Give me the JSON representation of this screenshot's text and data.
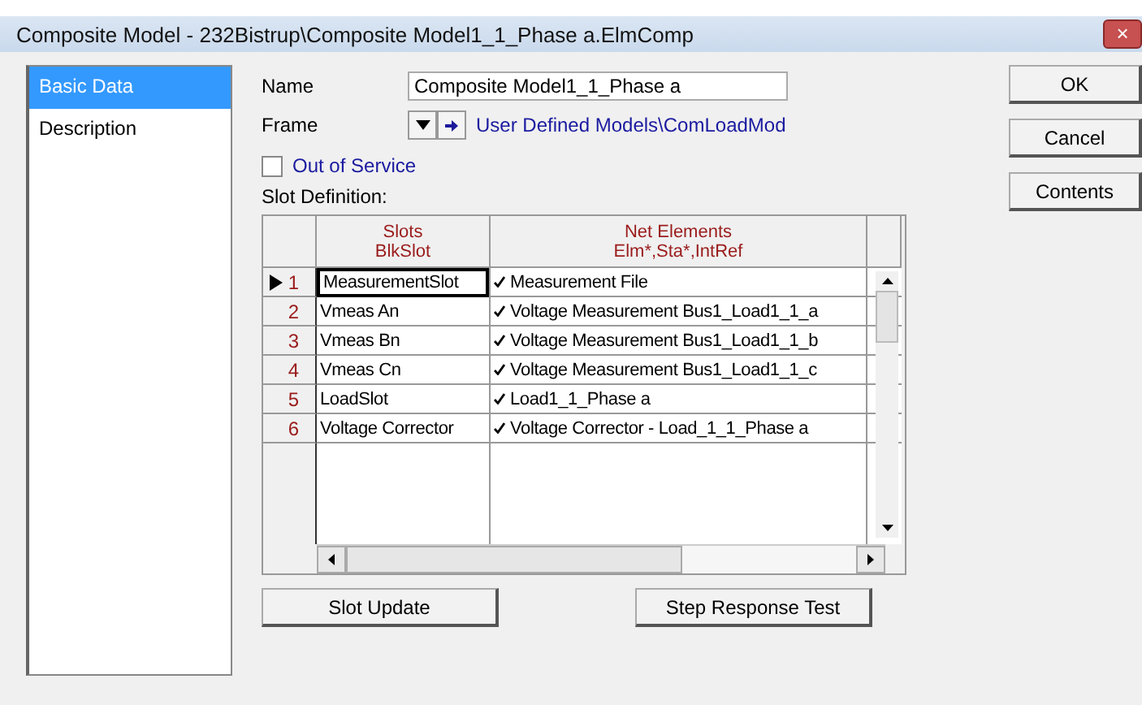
{
  "window": {
    "title": "Composite Model - 232Bistrup\\Composite Model1_1_Phase a.ElmComp",
    "close": "×"
  },
  "sidebar": {
    "items": [
      {
        "label": "Basic Data",
        "selected": true
      },
      {
        "label": "Description",
        "selected": false
      }
    ]
  },
  "form": {
    "name_label": "Name",
    "name_value": "Composite Model1_1_Phase a",
    "frame_label": "Frame",
    "frame_link": "User Defined Models\\ComLoadMod",
    "out_of_service": {
      "label": "Out of Service",
      "checked": false
    },
    "slot_definition_label": "Slot Definition:"
  },
  "table": {
    "columns": [
      {
        "title": "Slots",
        "subtitle": "BlkSlot"
      },
      {
        "title": "Net Elements",
        "subtitle": "Elm*,Sta*,IntRef"
      }
    ],
    "rows": [
      {
        "index": "1",
        "slot": "MeasurementSlot",
        "element": "Measurement File",
        "selected": true
      },
      {
        "index": "2",
        "slot": "Vmeas An",
        "element": "Voltage Measurement Bus1_Load1_1_a",
        "selected": false
      },
      {
        "index": "3",
        "slot": "Vmeas Bn",
        "element": "Voltage Measurement Bus1_Load1_1_b",
        "selected": false
      },
      {
        "index": "4",
        "slot": "Vmeas Cn",
        "element": "Voltage Measurement Bus1_Load1_1_c",
        "selected": false
      },
      {
        "index": "5",
        "slot": "LoadSlot",
        "element": "Load1_1_Phase a",
        "selected": false
      },
      {
        "index": "6",
        "slot": "Voltage Corrector",
        "element": "Voltage Corrector - Load_1_1_Phase a",
        "selected": false
      }
    ]
  },
  "bottom_buttons": [
    "Slot Update",
    "Step Response Test"
  ],
  "side_buttons": [
    "OK",
    "Cancel",
    "Contents"
  ]
}
